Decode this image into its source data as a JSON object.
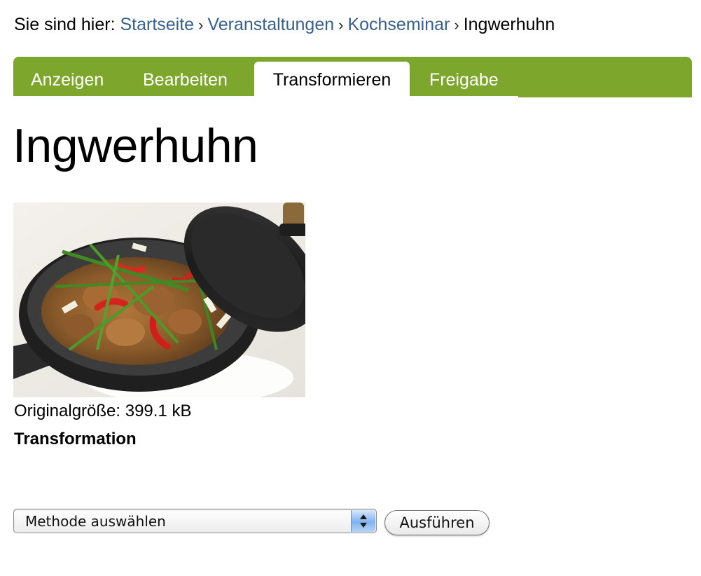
{
  "breadcrumb": {
    "prefix": "Sie sind hier:",
    "separator": "›",
    "items": [
      {
        "label": "Startseite"
      },
      {
        "label": "Veranstaltungen"
      },
      {
        "label": "Kochseminar"
      }
    ],
    "current": "Ingwerhuhn"
  },
  "tabs": [
    {
      "label": "Anzeigen",
      "active": false
    },
    {
      "label": "Bearbeiten",
      "active": false
    },
    {
      "label": "Transformieren",
      "active": true
    },
    {
      "label": "Freigabe",
      "active": false
    }
  ],
  "page": {
    "title": "Ingwerhuhn",
    "image_subject": "ginger chicken with red peppers and spring onions in a black cast-iron pan"
  },
  "image_info": {
    "original_size_label": "Originalgröße:",
    "original_size_value": "399.1 kB"
  },
  "transformation": {
    "heading": "Transformation",
    "method_select": {
      "selected": "Methode auswählen"
    },
    "execute_button": "Ausführen"
  },
  "colors": {
    "tab_bar": "#7da62d",
    "link": "#36608f",
    "select_arrow_blue": "#80b3ef"
  },
  "icons": {
    "select_arrows": "up-down-chevron-icon"
  }
}
